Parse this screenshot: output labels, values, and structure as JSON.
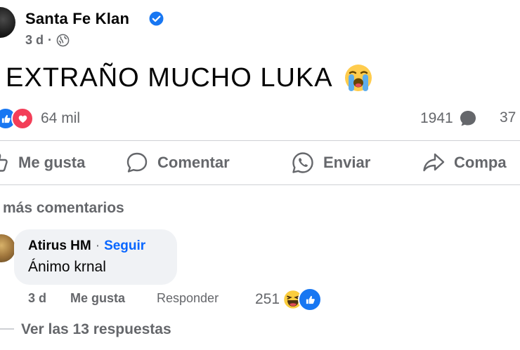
{
  "post": {
    "author": "Santa Fe Klan",
    "time": "3 d",
    "text": "EXTRAÑO MUCHO LUKA",
    "reactions_count": "64 mil",
    "comments_count": "1941",
    "shares_count": "37"
  },
  "actions": {
    "like": "Me gusta",
    "comment": "Comentar",
    "send": "Enviar",
    "share": "Compa"
  },
  "comments_section": {
    "more_label": "más comentarios",
    "comment": {
      "author": "Atirus HM",
      "separator": "·",
      "follow": "Seguir",
      "text": "Ánimo krnal",
      "time": "3 d",
      "like_label": "Me gusta",
      "reply_label": "Responder",
      "reactions_count": "251"
    },
    "replies_label": "Ver las 13 respuestas"
  },
  "icons": {
    "verified": "verified-badge-icon",
    "privacy": "globe-icon",
    "post_emoji": "loudly-crying-face-emoji",
    "like": "thumbs-up-icon",
    "comment": "speech-bubble-icon",
    "send": "whatsapp-icon",
    "share": "share-arrow-icon",
    "haha": "haha-reaction-icon"
  },
  "colors": {
    "accent": "#1877f2",
    "follow": "#0866ff",
    "love": "#f33e58",
    "secondary_text": "#65676b",
    "bubble": "#f0f2f5"
  }
}
